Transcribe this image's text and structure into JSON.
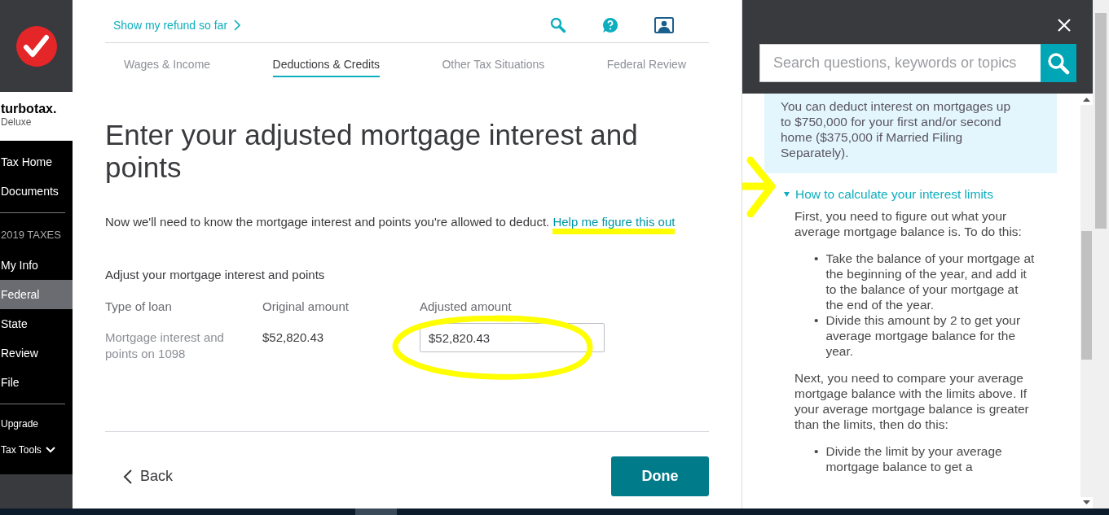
{
  "sidebar": {
    "brand": "turbotax.",
    "edition": "Deluxe",
    "items": [
      {
        "kind": "link",
        "label": "Tax Home",
        "selected": false
      },
      {
        "kind": "link",
        "label": "Documents",
        "selected": false
      },
      {
        "kind": "divider"
      },
      {
        "kind": "header",
        "label": "2019 TAXES"
      },
      {
        "kind": "link",
        "label": "My Info",
        "selected": false
      },
      {
        "kind": "link",
        "label": "Federal",
        "selected": true
      },
      {
        "kind": "link",
        "label": "State",
        "selected": false
      },
      {
        "kind": "link",
        "label": "Review",
        "selected": false
      },
      {
        "kind": "link",
        "label": "File",
        "selected": false
      },
      {
        "kind": "divider"
      },
      {
        "kind": "small",
        "label": "Upgrade",
        "selected": false
      },
      {
        "kind": "menu",
        "label": "Tax Tools",
        "selected": false,
        "expanded": false
      }
    ]
  },
  "header": {
    "refund_link": "Show my refund so far"
  },
  "tabs": [
    {
      "label": "Wages & Income",
      "selected": false
    },
    {
      "label": "Deductions & Credits",
      "selected": true
    },
    {
      "label": "Other Tax Situations",
      "selected": false
    },
    {
      "label": "Federal Review",
      "selected": false
    }
  ],
  "page": {
    "title": "Enter your adjusted mortgage interest and points",
    "intro": "Now we'll need to know the mortgage interest and points you're allowed to deduct.",
    "help_link": {
      "label": "Help me figure this out",
      "highlighted": true
    },
    "section_title": "Adjust your mortgage interest and points",
    "columns": [
      "Type of loan",
      "Original amount",
      "Adjusted amount"
    ],
    "rows": [
      {
        "type": "Mortgage interest and points on 1098",
        "original": "$52,820.43",
        "adjusted": "$52,820.43",
        "circled": true
      }
    ]
  },
  "footer": {
    "back": "Back",
    "done": "Done"
  },
  "help_panel": {
    "search_placeholder": "Search questions, keywords or topics",
    "info": "You can deduct interest on mortgages up to $750,000 for your first and/or second home ($375,000 if Married Filing Separately).",
    "topic": {
      "label": "How to calculate your interest limits",
      "expanded": true,
      "arrow": true,
      "content": [
        {
          "kind": "paragraph",
          "text": "First, you need to figure out what your average mortgage balance is. To do this:"
        },
        {
          "kind": "bullets",
          "marker": "•",
          "items": [
            "Take the balance of your mortgage at the beginning of the year, and add it to the balance of your mortgage at the end of the year.",
            "Divide this amount by 2 to get your average mortgage balance for the year."
          ]
        },
        {
          "kind": "paragraph",
          "text": "Next, you need to compare your average mortgage balance with the limits above. If your average mortgage balance is greater than the limits, then do this:"
        },
        {
          "kind": "bullets",
          "marker": "•",
          "items": [
            "Divide the limit by your average mortgage balance to get a"
          ]
        }
      ]
    }
  }
}
